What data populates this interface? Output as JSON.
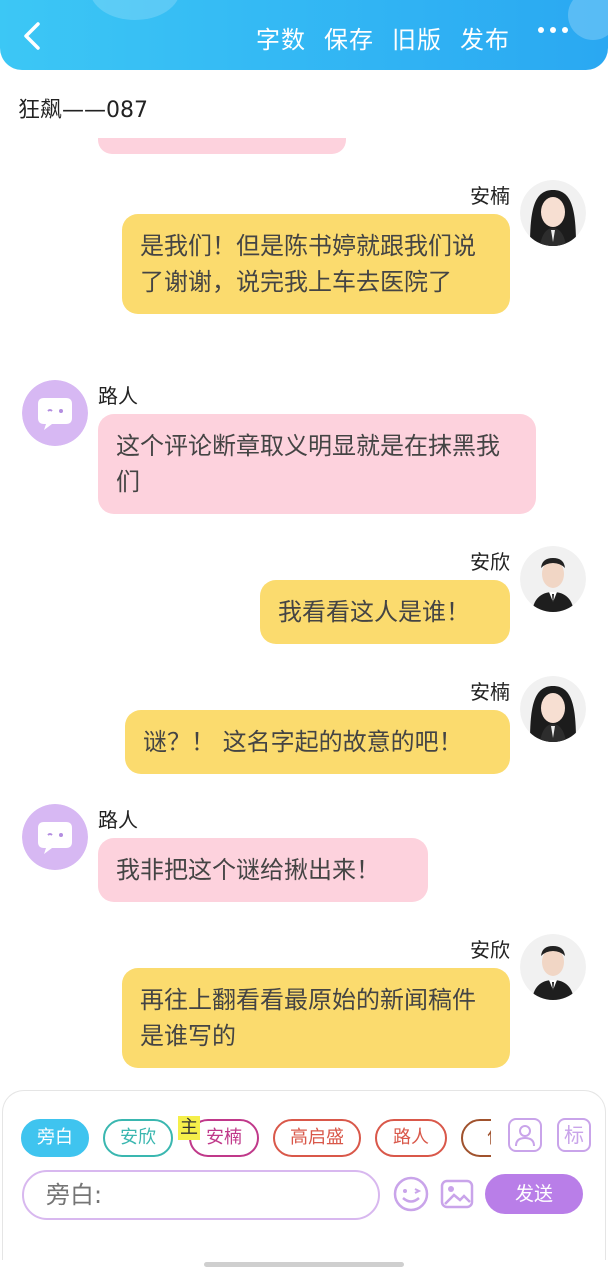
{
  "header": {
    "actions": [
      "字数",
      "保存",
      "旧版",
      "发布"
    ]
  },
  "doc_title": "狂飙——087",
  "messages": [
    {
      "side": "right",
      "speaker": "安楠",
      "avatar": "female-avatar",
      "text": "是我们！但是陈书婷就跟我们说了谢谢，说完我上车去医院了"
    },
    {
      "side": "left",
      "speaker": "路人",
      "avatar": "chat-bubble-avatar",
      "text": "这个评论断章取义明显就是在抹黑我们"
    },
    {
      "side": "right",
      "speaker": "安欣",
      "avatar": "male-avatar",
      "text": "我看看这人是谁！"
    },
    {
      "side": "right",
      "speaker": "安楠",
      "avatar": "female-avatar",
      "text": "谜？！ 这名字起的故意的吧！"
    },
    {
      "side": "left",
      "speaker": "路人",
      "avatar": "chat-bubble-avatar",
      "text": "我非把这个谜给揪出来！"
    },
    {
      "side": "right",
      "speaker": "安欣",
      "avatar": "male-avatar",
      "text": "再往上翻看看最原始的新闻稿件是谁写的"
    }
  ],
  "roles": [
    {
      "label": "旁白",
      "color": "#3fc4ef",
      "active": true
    },
    {
      "label": "安欣",
      "color": "#3ab7b0",
      "active": false
    },
    {
      "label": "安楠",
      "color": "#c0398a",
      "active": false
    },
    {
      "label": "高启盛",
      "color": "#d9584a",
      "active": false
    },
    {
      "label": "路人",
      "color": "#d9584a",
      "active": false
    },
    {
      "label": "作",
      "color": "#a0522d",
      "active": false
    }
  ],
  "main_badge": "主",
  "tool_label": "标",
  "input": {
    "placeholder": "旁白:"
  },
  "send_label": "发送",
  "colors": {
    "header": "#2aa8f2",
    "bubble_right": "#fbdb6e",
    "bubble_left": "#fdd2dd",
    "accent": "#b97ee8"
  }
}
